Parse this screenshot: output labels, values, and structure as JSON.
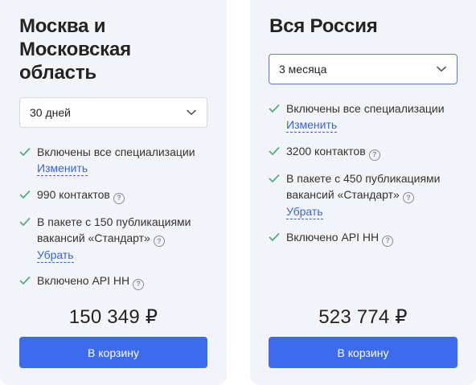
{
  "plans": [
    {
      "title_lines": [
        "Москва и",
        "Московская",
        "область"
      ],
      "period": "30 дней",
      "features": {
        "specializations": "Включены все специализации",
        "change_link": "Изменить",
        "contacts": "990 контактов",
        "package": "В пакете с 150 публикациями вакансий «Стандарт»",
        "remove_link": "Убрать",
        "api": "Включено API HH"
      },
      "price": "150 349 ₽",
      "cart_label": "В корзину"
    },
    {
      "title_lines": [
        "Вся Россия"
      ],
      "period": "3 месяца",
      "features": {
        "specializations": "Включены все специализации",
        "change_link": "Изменить",
        "contacts": "3200 контактов",
        "package": "В пакете с 450 публикациями вакансий «Стандарт»",
        "remove_link": "Убрать",
        "api": "Включено API HH"
      },
      "price": "523 774 ₽",
      "cart_label": "В корзину"
    }
  ],
  "icons": {
    "check": "check-icon",
    "help": "help-icon",
    "chevron": "chevron-down-icon"
  },
  "colors": {
    "accent": "#3d6bef",
    "check": "#4caf7a",
    "link": "#3367d6",
    "card_bg": "#f3f4f9"
  }
}
